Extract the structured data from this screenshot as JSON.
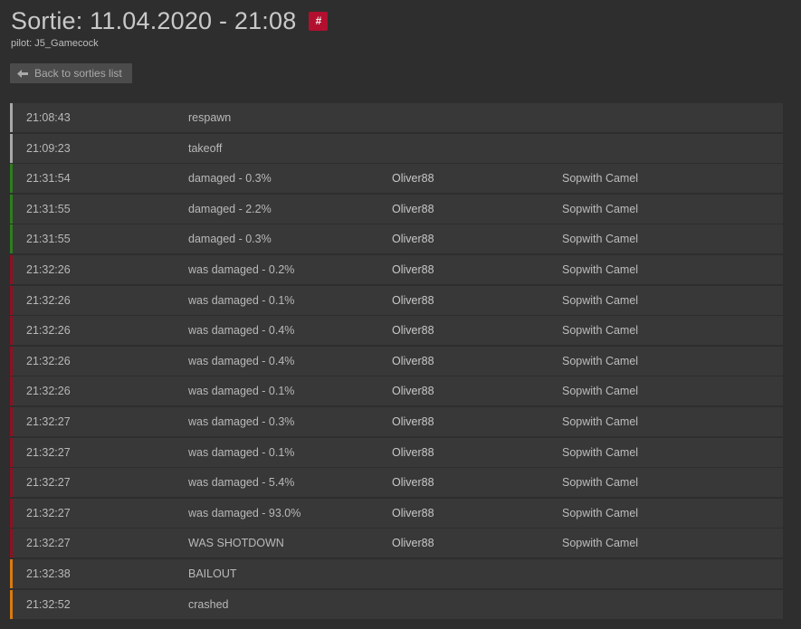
{
  "header": {
    "title": "Sortie: 11.04.2020 - 21:08",
    "hash_label": "#",
    "pilot": "pilot: J5_Gamecock"
  },
  "back_button": {
    "label": "Back to sorties list",
    "icon": "arrow-left-icon"
  },
  "colors": {
    "neutral": "#a8a8a8",
    "damage_dealt": "#2e7d1e",
    "damage_taken": "#8f1022",
    "bailout": "#d97a12",
    "badge": "#b30f2e"
  },
  "events": [
    {
      "time": "21:08:43",
      "event": "respawn",
      "pilot": "",
      "aircraft": "",
      "kind": "neutral"
    },
    {
      "time": "21:09:23",
      "event": "takeoff",
      "pilot": "",
      "aircraft": "",
      "kind": "neutral"
    },
    {
      "time": "21:31:54",
      "event": "damaged - 0.3%",
      "pilot": "Oliver88",
      "aircraft": "Sopwith Camel",
      "kind": "damage_dealt"
    },
    {
      "time": "21:31:55",
      "event": "damaged - 2.2%",
      "pilot": "Oliver88",
      "aircraft": "Sopwith Camel",
      "kind": "damage_dealt"
    },
    {
      "time": "21:31:55",
      "event": "damaged - 0.3%",
      "pilot": "Oliver88",
      "aircraft": "Sopwith Camel",
      "kind": "damage_dealt"
    },
    {
      "time": "21:32:26",
      "event": "was damaged - 0.2%",
      "pilot": "Oliver88",
      "aircraft": "Sopwith Camel",
      "kind": "damage_taken"
    },
    {
      "time": "21:32:26",
      "event": "was damaged - 0.1%",
      "pilot": "Oliver88",
      "aircraft": "Sopwith Camel",
      "kind": "damage_taken"
    },
    {
      "time": "21:32:26",
      "event": "was damaged - 0.4%",
      "pilot": "Oliver88",
      "aircraft": "Sopwith Camel",
      "kind": "damage_taken"
    },
    {
      "time": "21:32:26",
      "event": "was damaged - 0.4%",
      "pilot": "Oliver88",
      "aircraft": "Sopwith Camel",
      "kind": "damage_taken"
    },
    {
      "time": "21:32:26",
      "event": "was damaged - 0.1%",
      "pilot": "Oliver88",
      "aircraft": "Sopwith Camel",
      "kind": "damage_taken"
    },
    {
      "time": "21:32:27",
      "event": "was damaged - 0.3%",
      "pilot": "Oliver88",
      "aircraft": "Sopwith Camel",
      "kind": "damage_taken"
    },
    {
      "time": "21:32:27",
      "event": "was damaged - 0.1%",
      "pilot": "Oliver88",
      "aircraft": "Sopwith Camel",
      "kind": "damage_taken"
    },
    {
      "time": "21:32:27",
      "event": "was damaged - 5.4%",
      "pilot": "Oliver88",
      "aircraft": "Sopwith Camel",
      "kind": "damage_taken"
    },
    {
      "time": "21:32:27",
      "event": "was damaged - 93.0%",
      "pilot": "Oliver88",
      "aircraft": "Sopwith Camel",
      "kind": "damage_taken"
    },
    {
      "time": "21:32:27",
      "event": "WAS SHOTDOWN",
      "pilot": "Oliver88",
      "aircraft": "Sopwith Camel",
      "kind": "damage_taken"
    },
    {
      "time": "21:32:38",
      "event": "BAILOUT",
      "pilot": "",
      "aircraft": "",
      "kind": "bailout"
    },
    {
      "time": "21:32:52",
      "event": "crashed",
      "pilot": "",
      "aircraft": "",
      "kind": "bailout"
    }
  ]
}
